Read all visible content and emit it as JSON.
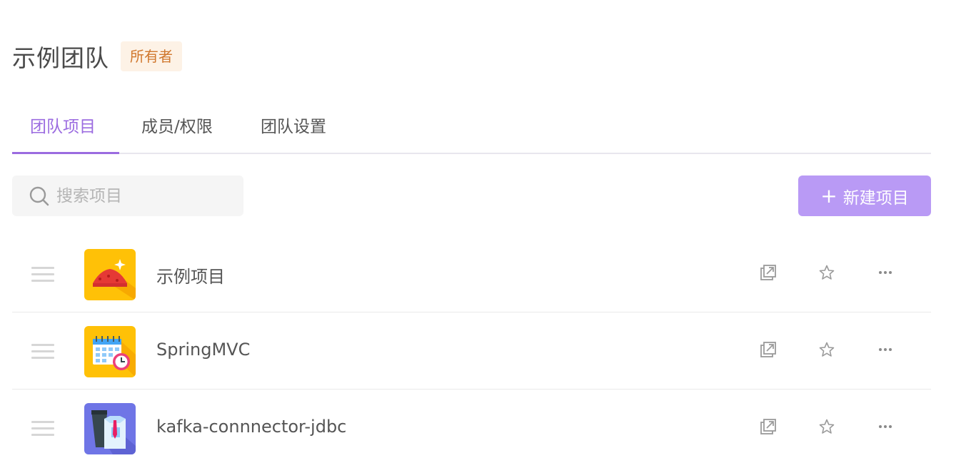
{
  "team": {
    "name": "示例团队",
    "role_badge": "所有者"
  },
  "tabs": [
    {
      "label": "团队项目",
      "active": true
    },
    {
      "label": "成员/权限",
      "active": false
    },
    {
      "label": "团队设置",
      "active": false
    }
  ],
  "search": {
    "placeholder": "搜索项目",
    "value": ""
  },
  "new_project": {
    "label": "新建项目",
    "icon": "plus-icon"
  },
  "projects": [
    {
      "name": "示例项目",
      "icon": "landscape-icon",
      "icon_bg": "#ffc107"
    },
    {
      "name": "SpringMVC",
      "icon": "calendar-clock-icon",
      "icon_bg": "#ffc107"
    },
    {
      "name": "kafka-connnector-jdbc",
      "icon": "shirt-tie-icon",
      "icon_bg": "#6f75e6"
    }
  ],
  "row_actions": [
    "external-link-icon",
    "star-icon",
    "more-icon"
  ],
  "colors": {
    "accent": "#9b6be0",
    "button": "#b99af5",
    "badge_bg": "#fdf2e6",
    "badge_text": "#d0772d"
  }
}
